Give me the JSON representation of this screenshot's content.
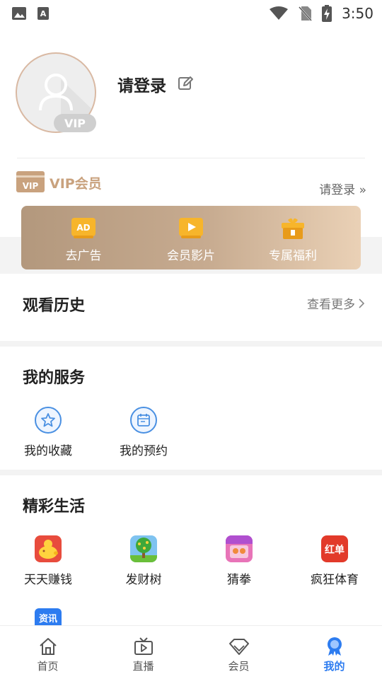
{
  "status_bar": {
    "time": "3:50"
  },
  "profile": {
    "login_prompt": "请登录",
    "vip_badge": "VIP"
  },
  "vip": {
    "logo_text": "VIP",
    "title": "VIP会员",
    "login_link": "请登录 »",
    "features": [
      {
        "label": "去广告",
        "icon": "ad-icon",
        "icon_text": "AD"
      },
      {
        "label": "会员影片",
        "icon": "play-screen-icon"
      },
      {
        "label": "专属福利",
        "icon": "gift-icon"
      }
    ]
  },
  "history": {
    "title": "观看历史",
    "more": "查看更多"
  },
  "services": {
    "title": "我的服务",
    "items": [
      {
        "label": "我的收藏",
        "icon": "star-icon"
      },
      {
        "label": "我的预约",
        "icon": "calendar-icon"
      }
    ]
  },
  "life": {
    "title": "精彩生活",
    "items": [
      {
        "label": "天天赚钱",
        "icon": "piggy-bank-icon"
      },
      {
        "label": "发财树",
        "icon": "money-tree-icon"
      },
      {
        "label": "猜拳",
        "icon": "rock-paper-scissors-icon"
      },
      {
        "label": "疯狂体育",
        "icon": "red-sheet-icon",
        "icon_text": "红单"
      },
      {
        "label": "",
        "icon": "news-icon",
        "icon_text": "资讯"
      }
    ]
  },
  "nav": {
    "items": [
      {
        "label": "首页",
        "icon": "home-icon"
      },
      {
        "label": "直播",
        "icon": "tv-icon"
      },
      {
        "label": "会员",
        "icon": "diamond-icon"
      },
      {
        "label": "我的",
        "icon": "medal-icon",
        "active": true
      }
    ]
  },
  "colors": {
    "accent": "#2d7cf0",
    "vip_gold": "#c9a27e",
    "service_blue": "#4a90e2"
  }
}
